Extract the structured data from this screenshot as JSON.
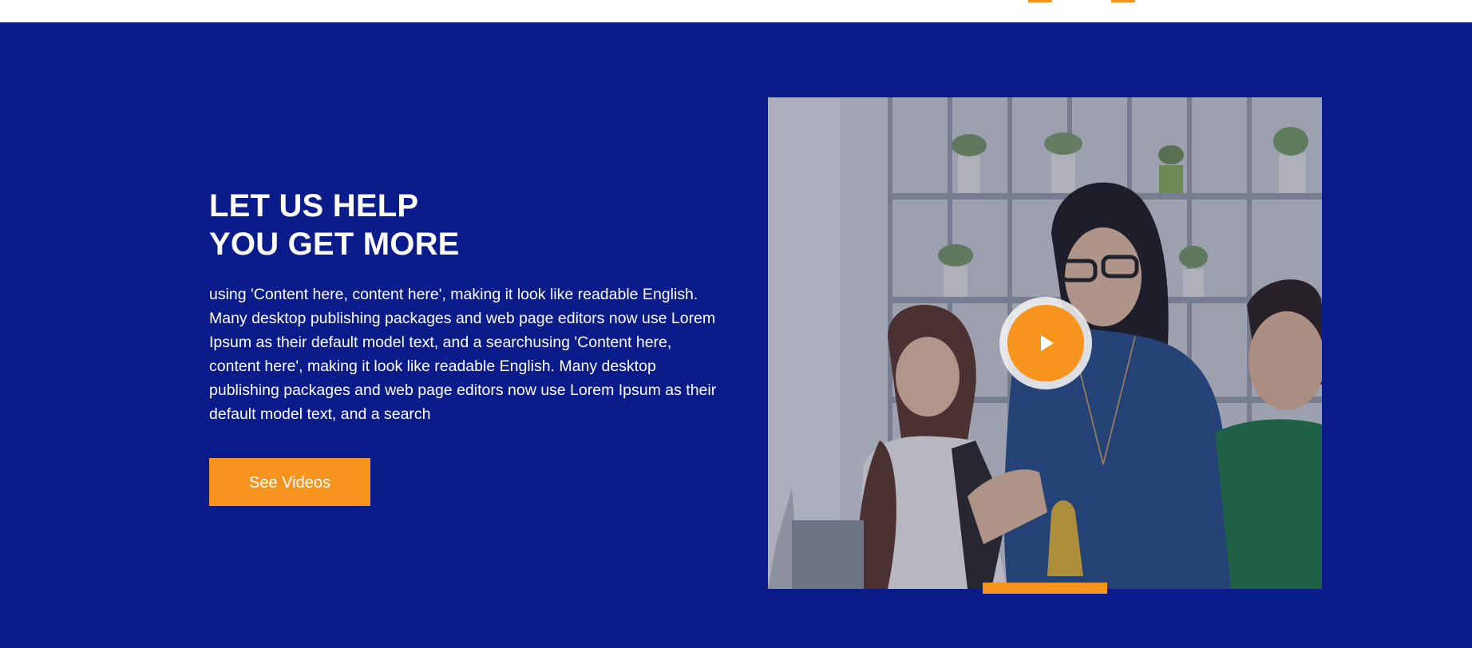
{
  "hero": {
    "heading_line1": "LET US HELP",
    "heading_line2": "YOU GET MORE",
    "body": "using 'Content here, content here', making it look like readable English. Many desktop publishing packages and web page editors now use Lorem Ipsum as their default model text, and a searchusing 'Content here, content here', making it look like readable English. Many desktop publishing packages and web page editors now use Lorem Ipsum as their default model text, and a search",
    "cta_label": "See Videos"
  },
  "media": {
    "image_subject": "office-team-photo",
    "play_icon": "play-icon"
  },
  "colors": {
    "background": "#0a1b8a",
    "accent": "#f7941d",
    "text": "#ffffff"
  }
}
